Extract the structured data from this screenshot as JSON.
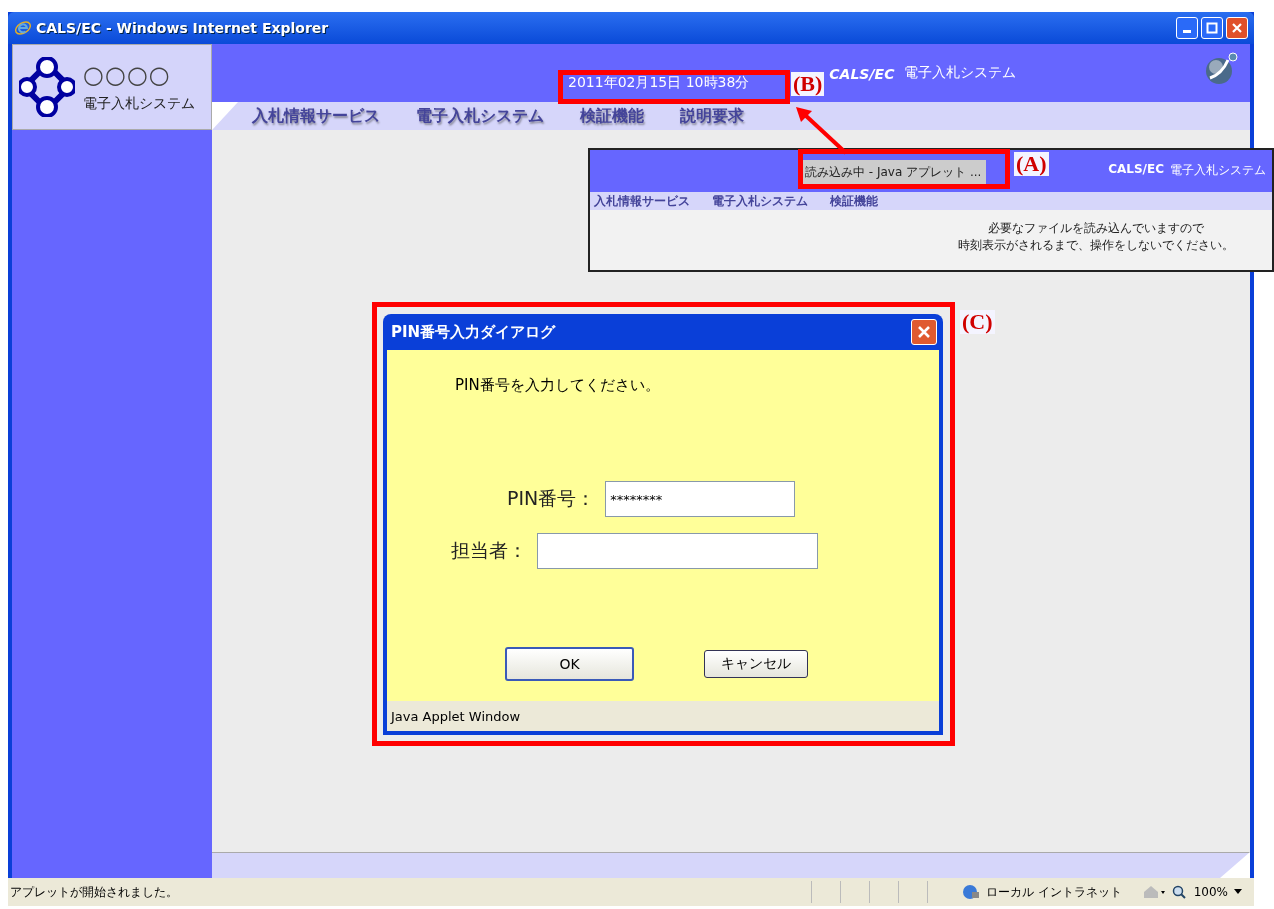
{
  "window": {
    "title": "CALS/EC - Windows Internet Explorer"
  },
  "header": {
    "logo_mark": "○○○○",
    "logo_subtitle": "電子入札システム",
    "datetime": "2011年02月15日 10時38分",
    "brand": "CALS/EC",
    "system_name": "電子入札システム"
  },
  "menu": [
    "入札情報サービス",
    "電子入札システム",
    "検証機能",
    "説明要求"
  ],
  "inset_screenshot": {
    "loading_label": "読み込み中 - Java アプレット ...",
    "brand": "CALS/EC",
    "system_name": "電子入札システム",
    "menu": [
      "入札情報サービス",
      "電子入札システム",
      "検証機能"
    ],
    "message": [
      "必要なファイルを読み込んでいますので",
      "時刻表示がされるまで、操作をしないでください。"
    ]
  },
  "dialog": {
    "title": "PIN番号入力ダイアログ",
    "prompt": "PIN番号を入力してください。",
    "fields": [
      {
        "label": "PIN番号：",
        "value": "********"
      },
      {
        "label": "担当者："
      }
    ],
    "buttons": [
      "OK",
      "キャンセル"
    ],
    "footer": "Java Applet Window"
  },
  "annotations": [
    {
      "label": "(A)"
    },
    {
      "label": "(B)"
    },
    {
      "label": "(C)"
    }
  ],
  "status_bar": {
    "message": "アプレットが開始されました。",
    "zone": "ローカル イントラネット",
    "zoom": "100%"
  }
}
